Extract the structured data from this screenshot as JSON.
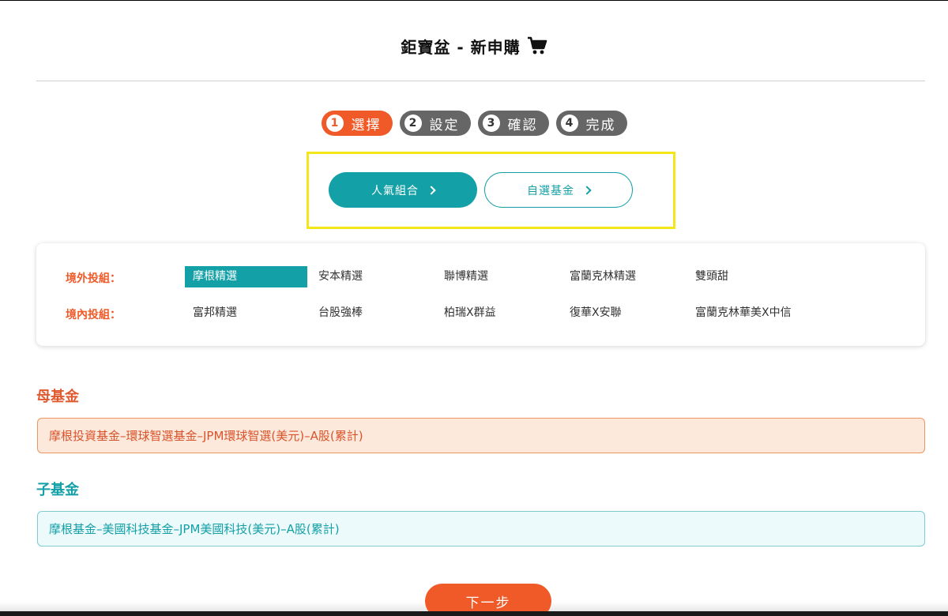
{
  "header": {
    "title": "鉅寶盆 - 新申購",
    "icon": "shopping-cart-icon"
  },
  "steps": [
    {
      "num": "1",
      "label": "選擇",
      "active": true
    },
    {
      "num": "2",
      "label": "設定",
      "active": false
    },
    {
      "num": "3",
      "label": "確認",
      "active": false
    },
    {
      "num": "4",
      "label": "完成",
      "active": false
    }
  ],
  "mode": {
    "popular_label": "人氣組合",
    "custom_label": "自選基金"
  },
  "portfolio": {
    "overseas_label": "境外投組：",
    "overseas": [
      "摩根精選",
      "安本精選",
      "聯博精選",
      "富蘭克林精選",
      "雙頭甜"
    ],
    "domestic_label": "境內投組：",
    "domestic": [
      "富邦精選",
      "台股強棒",
      "柏瑞X群益",
      "復華X安聯",
      "富蘭克林華美X中信"
    ],
    "selected": "摩根精選"
  },
  "mother_fund": {
    "title": "母基金",
    "name": "摩根投資基金–環球智選基金–JPM環球智選(美元)–A股(累計)"
  },
  "child_fund": {
    "title": "子基金",
    "name": "摩根基金–美國科技基金–JPM美國科技(美元)–A股(累計)"
  },
  "next_label": "下一步",
  "colors": {
    "accent_orange": "#f05a28",
    "accent_teal": "#13a0a7",
    "step_inactive": "#666666"
  }
}
